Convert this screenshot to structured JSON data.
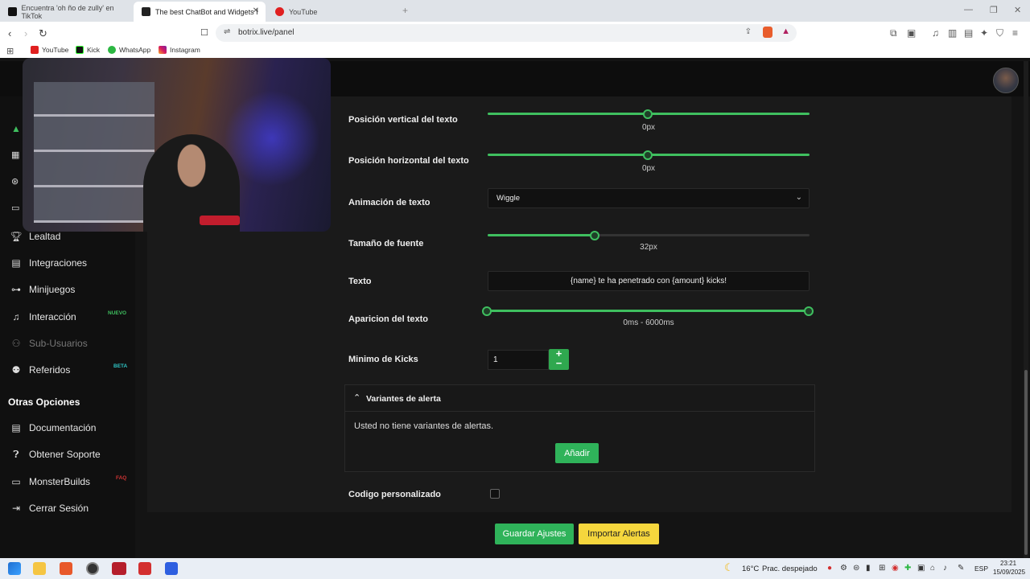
{
  "browser": {
    "tabs": [
      {
        "label": "Encuentra 'oh ño de zully' en TikTok"
      },
      {
        "label": "The best ChatBot and Widgets f"
      },
      {
        "label": "YouTube"
      }
    ],
    "url": "botrix.live/panel",
    "bookmarks": [
      "YouTube",
      "Kick",
      "WhatsApp",
      "Instagram"
    ]
  },
  "sidebar": {
    "items": [
      {
        "label": "Lealtad",
        "icon": "trophy-icon"
      },
      {
        "label": "Integraciones",
        "icon": "puzzle-icon"
      },
      {
        "label": "Minijuegos",
        "icon": "gamepad-icon"
      },
      {
        "label": "Interacción",
        "icon": "music-icon",
        "badge": "NUEVO"
      },
      {
        "label": "Sub-Usuarios",
        "icon": "users-icon"
      },
      {
        "label": "Referidos",
        "icon": "people-icon",
        "badge": "BETA"
      }
    ],
    "section_title": "Otras Opciones",
    "other": [
      {
        "label": "Documentación",
        "icon": "book-icon"
      },
      {
        "label": "Obtener Soporte",
        "icon": "question-icon"
      },
      {
        "label": "MonsterBuilds",
        "icon": "laptop-icon",
        "badge": "FAQ"
      },
      {
        "label": "Cerrar Sesión",
        "icon": "logout-icon"
      }
    ]
  },
  "settings": {
    "vertical_label": "Posición vertical del texto",
    "vertical_value": "0px",
    "vertical_fraction": 0.5,
    "horizontal_label": "Posición horizontal del texto",
    "horizontal_value": "0px",
    "horizontal_fraction": 0.5,
    "animation_label": "Animación de texto",
    "animation_value": "Wiggle",
    "font_size_label": "Tamaño de fuente",
    "font_size_value": "32px",
    "font_size_fraction": 0.335,
    "text_label": "Texto",
    "text_value": "{name} te ha penetrado con {amount} kicks!",
    "appearance_label": "Aparicion del texto",
    "appearance_value": "0ms - 6000ms",
    "min_kicks_label": "Minimo de Kicks",
    "min_kicks_value": "1",
    "variants_title": "Variantes de alerta",
    "variants_empty": "Usted no tiene variantes de alertas.",
    "add_label": "Añadir",
    "custom_code_label": "Codigo personalizado",
    "save_label": "Guardar Ajustes",
    "import_label": "Importar Alertas"
  },
  "taskbar": {
    "weather": "16°C",
    "weather_desc": "Prac. despejado",
    "lang": "ESP",
    "time": "23:21",
    "date": "15/09/2025"
  },
  "colors": {
    "accent": "#2fb35a",
    "slider": "#3fbf5f",
    "yellow": "#f5d63d"
  }
}
